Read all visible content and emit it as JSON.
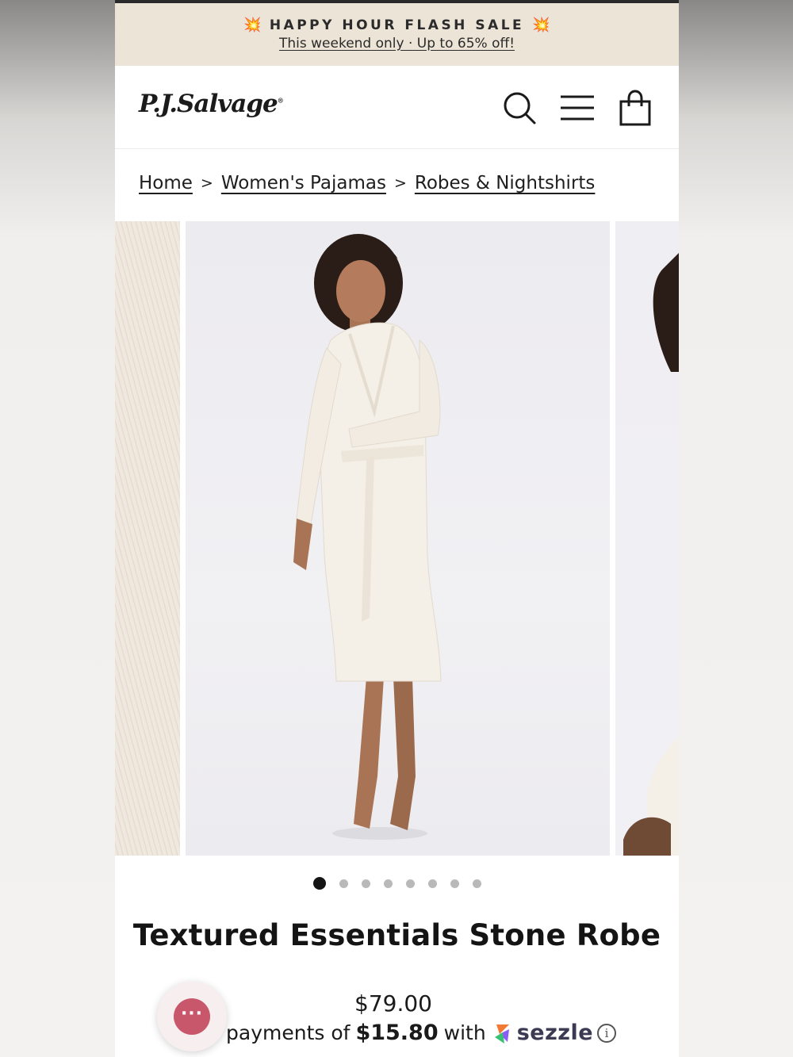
{
  "announcement": {
    "title": "HAPPY HOUR FLASH SALE",
    "subtitle": "This weekend only · Up to 65% off!",
    "burst_icon": "💥"
  },
  "header": {
    "logo": "P.J.Salvage",
    "logo_mark": "®",
    "icons": [
      "search-icon",
      "menu-icon",
      "shopping-bag-icon"
    ]
  },
  "breadcrumb": {
    "items": [
      "Home",
      "Women's Pajamas",
      "Robes & Nightshirts"
    ],
    "separator": ">"
  },
  "gallery": {
    "dot_count": 8,
    "active_index": 0,
    "zoom_icon": "zoom-icon"
  },
  "product": {
    "title": "Textured Essentials Stone Robe",
    "price": "$79.00",
    "installment_prefix": "payments of",
    "installment_amount": "$15.80",
    "installment_with": "with",
    "provider": "sezzle",
    "info_symbol": "i"
  },
  "chat": {
    "label": "···",
    "icon": "chat-bubble-icon",
    "color": "#c9576b"
  },
  "colors": {
    "announcement_bg": "#ece4d6",
    "burst": "#e0583a",
    "text": "#141414"
  }
}
